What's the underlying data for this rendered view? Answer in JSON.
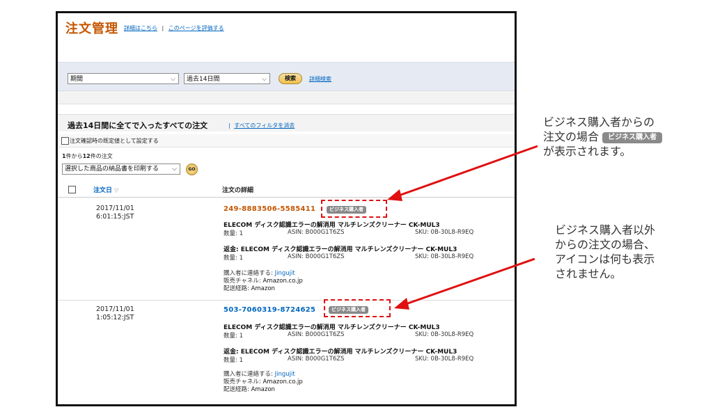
{
  "header": {
    "title": "注文管理",
    "link_details": "詳細はこちら",
    "separator": "|",
    "link_rate": "このページを評価する"
  },
  "filters": {
    "period_label": "期間",
    "range_value": "過去14日間",
    "search_button": "検索",
    "advanced_search": "詳細検索"
  },
  "section": {
    "title": "過去14日間に全てで入ったすべての注文",
    "separator": "|",
    "clear_filters": "すべてのフィルタを消去",
    "default_setting_label": "注文確認時の既定値として設定する",
    "count_from": "1",
    "count_text_mid": "件から",
    "count_to": "12",
    "count_text_end": "件の注文",
    "print_select": "選択した商品の納品書を印刷する",
    "go_button": "GO"
  },
  "columns": {
    "date": "注文日",
    "detail": "注文の詳細"
  },
  "orders": [
    {
      "date": "2017/11/01",
      "time": "6:01:15:JST",
      "order_id": "249-8883506-5585411",
      "badge": "ビジネス購入者",
      "items": [
        {
          "name": "ELECOM ディスク認識エラーの解消用 マルチレンズクリーナー CK-MUL3",
          "qty_label": "数量:",
          "qty": "1",
          "asin_label": "ASIN:",
          "asin": "B000G1T6ZS",
          "sku_label": "SKU:",
          "sku": "0B-30L8-R9EQ"
        },
        {
          "name": "返金: ELECOM ディスク認識エラーの解消用 マルチレンズクリーナー CK-MUL3",
          "qty_label": "数量:",
          "qty": "1",
          "asin_label": "ASIN:",
          "asin": "B000G1T6ZS",
          "sku_label": "SKU:",
          "sku": "0B-30L8-R9EQ"
        }
      ],
      "contact_label": "購入者に連絡する:",
      "contact_name": "Jingujit",
      "channel_label": "販売チャネル:",
      "channel": "Amazon.co.jp",
      "route_label": "配送経路:",
      "route": "Amazon"
    },
    {
      "date": "2017/11/01",
      "time": "1:05:12:JST",
      "order_id": "503-7060319-8724625",
      "badge": "ビジネス購入者",
      "items": [
        {
          "name": "ELECOM ディスク認識エラーの解消用 マルチレンズクリーナー CK-MUL3",
          "qty_label": "数量:",
          "qty": "1",
          "asin_label": "ASIN:",
          "asin": "B000G1T6ZS",
          "sku_label": "SKU:",
          "sku": "0B-30L8-R9EQ"
        },
        {
          "name": "返金: ELECOM ディスク認識エラーの解消用 マルチレンズクリーナー CK-MUL3",
          "qty_label": "数量:",
          "qty": "1",
          "asin_label": "ASIN:",
          "asin": "B000G1T6ZS",
          "sku_label": "SKU:",
          "sku": "0B-30L8-R9EQ"
        }
      ],
      "contact_label": "購入者に連絡する:",
      "contact_name": "Jingujit",
      "channel_label": "販売チャネル:",
      "channel": "Amazon.co.jp",
      "route_label": "配送経路:",
      "route": "Amazon"
    }
  ],
  "annotations": {
    "a1_line1": "ビジネス購入者からの",
    "a1_line2_pre": "注文の場合",
    "a1_badge": "ビジネス購入者",
    "a1_line3": "が表示されます。",
    "a2_line1": "ビジネス購入者以外",
    "a2_line2": "からの注文の場合、",
    "a2_line3": "アイコンは何も表示",
    "a2_line4": "されません。"
  },
  "colors": {
    "title": "#c45500",
    "link": "#0066c0",
    "order_id_1": "#c45500",
    "order_id_2": "#0066c0",
    "highlight": "#e01010",
    "badge": "#888888"
  }
}
